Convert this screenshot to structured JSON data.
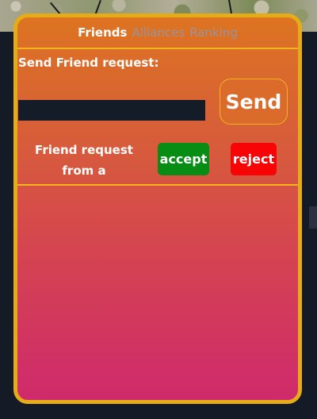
{
  "tabs": [
    {
      "label": "Friends",
      "active": true
    },
    {
      "label": "Alliances",
      "active": false
    },
    {
      "label": "Ranking",
      "active": false
    }
  ],
  "send_request": {
    "label": "Send Friend request:",
    "input_value": "",
    "button_label": "Send"
  },
  "requests": [
    {
      "text": "Friend request from a",
      "accept_label": "accept",
      "reject_label": "reject"
    }
  ],
  "colors": {
    "panel_border": "#e5ac17",
    "gradient_top": "#dd7421",
    "gradient_bottom": "#cf2a6c",
    "accept": "#078d13",
    "reject": "#f80407",
    "input_bg": "#141c28"
  }
}
